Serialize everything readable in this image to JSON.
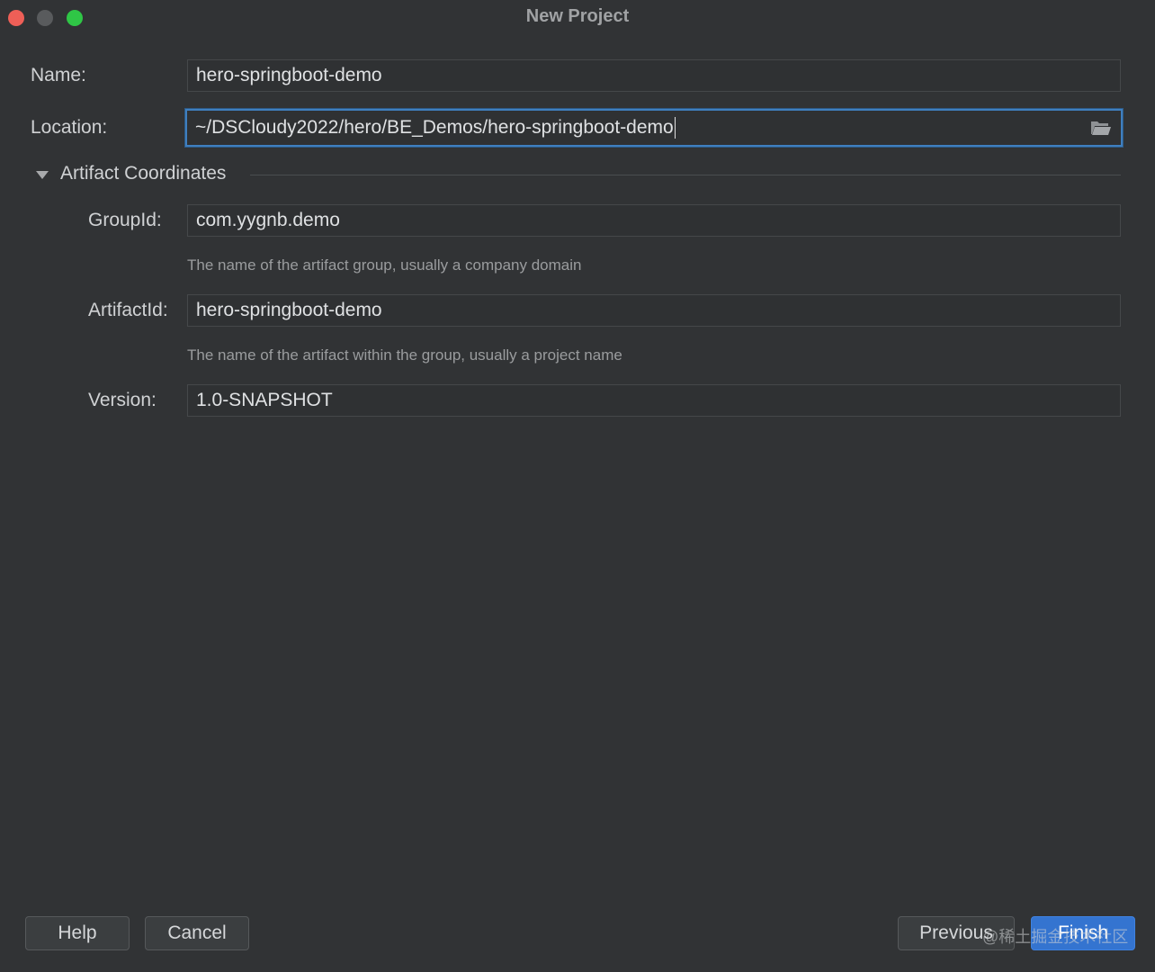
{
  "window": {
    "title": "New Project"
  },
  "form": {
    "name": {
      "label": "Name:",
      "value": "hero-springboot-demo"
    },
    "location": {
      "label": "Location:",
      "value": "~/DSCloudy2022/hero/BE_Demos/hero-springboot-demo"
    },
    "artifact_section": {
      "title": "Artifact Coordinates",
      "expanded": true
    },
    "group_id": {
      "label": "GroupId:",
      "value": "com.yygnb.demo",
      "hint": "The name of the artifact group, usually a company domain"
    },
    "artifact_id": {
      "label": "ArtifactId:",
      "value": "hero-springboot-demo",
      "hint": "The name of the artifact within the group, usually a project name"
    },
    "version": {
      "label": "Version:",
      "value": "1.0-SNAPSHOT"
    }
  },
  "footer": {
    "help": "Help",
    "cancel": "Cancel",
    "previous": "Previous",
    "finish": "Finish"
  },
  "watermark": "@稀土掘金技术社区",
  "colors": {
    "background": "#313335",
    "accent": "#3474d0",
    "focus_border": "#3f7fbf",
    "close": "#ee5f57",
    "minimize": "#595b5d",
    "maximize": "#2fc646"
  },
  "icons": {
    "location_browse": "folder-icon",
    "section_toggle": "triangle-down-icon"
  }
}
